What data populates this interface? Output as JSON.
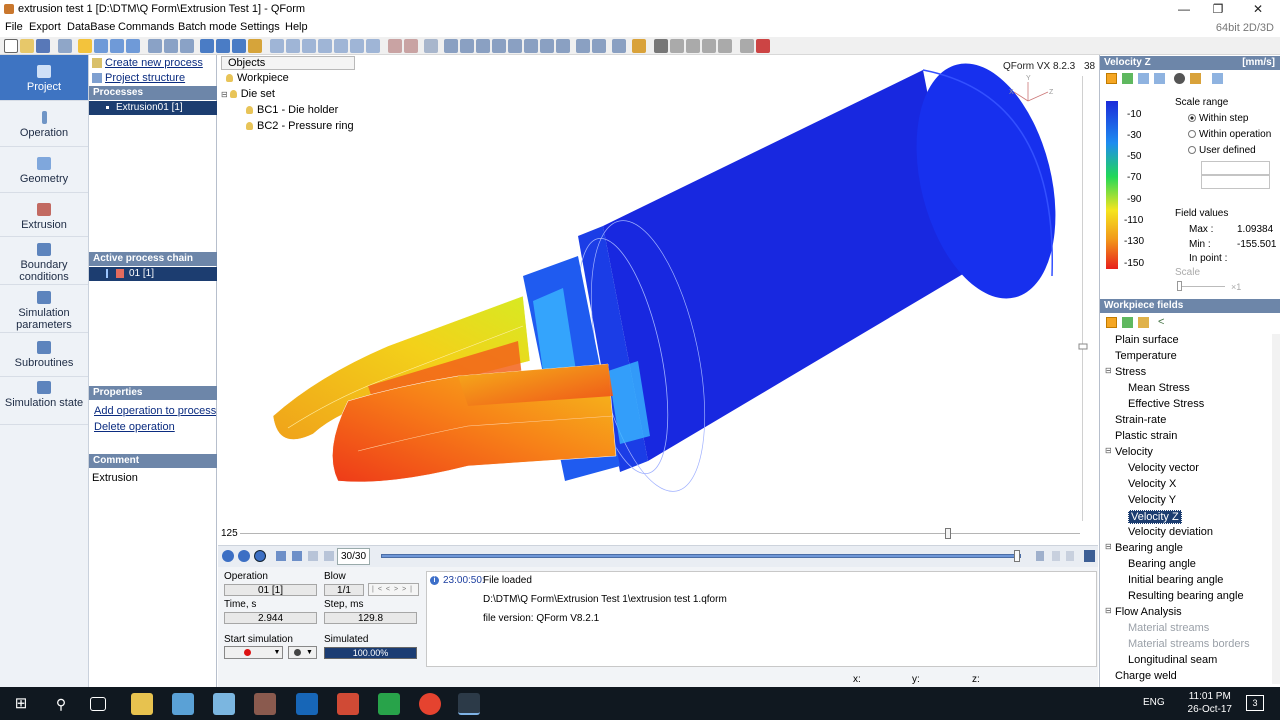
{
  "window": {
    "title": "extrusion test 1  [D:\\DTM\\Q Form\\Extrusion Test 1] - QForm",
    "min": "—",
    "max": "❐",
    "close": "✕"
  },
  "menu": {
    "items": [
      "File",
      "Export",
      "DataBase",
      "Commands",
      "Batch mode",
      "Settings",
      "Help"
    ],
    "arch": "64bit 2D/3D"
  },
  "leftnav": {
    "items": [
      {
        "label": "Project",
        "icon": "project-icon"
      },
      {
        "label": "Operation",
        "icon": "operation-icon"
      },
      {
        "label": "Geometry",
        "icon": "geometry-icon"
      },
      {
        "label": "Extrusion",
        "icon": "extrusion-icon"
      },
      {
        "label": "Boundary conditions",
        "icon": "boundary-icon"
      },
      {
        "label": "Simulation parameters",
        "icon": "parameters-icon"
      },
      {
        "label": "Subroutines",
        "icon": "subroutines-icon"
      },
      {
        "label": "Simulation state",
        "icon": "state-icon"
      }
    ]
  },
  "process": {
    "create_link": "Create new process",
    "structure_link": "Project structure",
    "processes_header": "Processes",
    "process_item": "Extrusion01 [1]",
    "chain_header": "Active process chain",
    "chain_item": "01 [1]",
    "properties_header": "Properties",
    "add_op_link": "Add operation to process chain",
    "delete_op_link": "Delete operation",
    "comment_header": "Comment",
    "comment_text": "Extrusion"
  },
  "objects": {
    "tab": "Objects",
    "workpiece": "Workpiece",
    "dieset": "Die set",
    "bc1": "BC1 - Die holder",
    "bc2": "BC2 - Pressure ring"
  },
  "viewport": {
    "version": "QForm VX 8.2.3",
    "side_number": "38",
    "axis_y": "Y",
    "axis_x": "X",
    "axis_z": "Z"
  },
  "slider": {
    "value": "125"
  },
  "playback": {
    "step_counter": "30/30"
  },
  "info": {
    "operation_label": "Operation",
    "operation_value": "01 [1]",
    "blow_label": "Blow",
    "blow_value": "1/1",
    "time_label": "Time, s",
    "time_value": "2.944",
    "step_label": "Step, ms",
    "step_value": "129.8",
    "start_label": "Start simulation",
    "simulated_label": "Simulated",
    "simulated_value": "100.00%",
    "simulated_fraction": 1.0
  },
  "log": {
    "time": "23:00:50:",
    "message": "File loaded",
    "path": "D:\\DTM\\Q Form\\Extrusion Test 1\\extrusion test 1.qform",
    "version": "file version: QForm V8.2.1"
  },
  "coords": {
    "x": "x:",
    "y": "y:",
    "z": "z:"
  },
  "scale": {
    "header_title": "Velocity Z",
    "header_unit": "[mm/s]",
    "ticks": [
      "-10",
      "-30",
      "-50",
      "-70",
      "-90",
      "-110",
      "-130",
      "-150"
    ],
    "range_label": "Scale range",
    "within_step": "Within step",
    "within_operation": "Within operation",
    "user_defined": "User defined",
    "field_values_label": "Field values",
    "max_label": "Max :",
    "max_value": "1.09384",
    "min_label": "Min :",
    "min_value": "-155.501",
    "in_point_label": "In point :",
    "scale_label": "Scale",
    "scale_mult": "×1",
    "colors": {
      "top": "#1c2bd9",
      "mid": "#22d858",
      "low": "#f5e51e",
      "bottom": "#e8201c"
    }
  },
  "fields": {
    "header": "Workpiece fields",
    "items": [
      {
        "label": "Plain surface",
        "level": 0,
        "state": "normal"
      },
      {
        "label": "Temperature",
        "level": 0,
        "state": "normal"
      },
      {
        "label": "Stress",
        "level": 0,
        "state": "group"
      },
      {
        "label": "Mean Stress",
        "level": 1,
        "state": "normal"
      },
      {
        "label": "Effective Stress",
        "level": 1,
        "state": "normal"
      },
      {
        "label": "Strain-rate",
        "level": 0,
        "state": "normal"
      },
      {
        "label": "Plastic strain",
        "level": 0,
        "state": "normal"
      },
      {
        "label": "Velocity",
        "level": 0,
        "state": "group"
      },
      {
        "label": "Velocity vector",
        "level": 1,
        "state": "normal"
      },
      {
        "label": "Velocity X",
        "level": 1,
        "state": "normal"
      },
      {
        "label": "Velocity Y",
        "level": 1,
        "state": "normal"
      },
      {
        "label": "Velocity Z",
        "level": 1,
        "state": "selected"
      },
      {
        "label": "Velocity deviation",
        "level": 1,
        "state": "normal"
      },
      {
        "label": "Bearing angle",
        "level": 0,
        "state": "group"
      },
      {
        "label": "Bearing angle",
        "level": 1,
        "state": "normal"
      },
      {
        "label": "Initial bearing angle",
        "level": 1,
        "state": "normal"
      },
      {
        "label": "Resulting bearing angle",
        "level": 1,
        "state": "normal"
      },
      {
        "label": "Flow Analysis",
        "level": 0,
        "state": "group"
      },
      {
        "label": "Material streams",
        "level": 1,
        "state": "disabled"
      },
      {
        "label": "Material streams borders",
        "level": 1,
        "state": "disabled"
      },
      {
        "label": "Longitudinal seam",
        "level": 1,
        "state": "normal"
      },
      {
        "label": "Charge weld",
        "level": 0,
        "state": "normal"
      }
    ]
  },
  "taskbar": {
    "lang": "ENG",
    "time": "11:01 PM",
    "date": "26-Oct-17",
    "notif": "3"
  }
}
